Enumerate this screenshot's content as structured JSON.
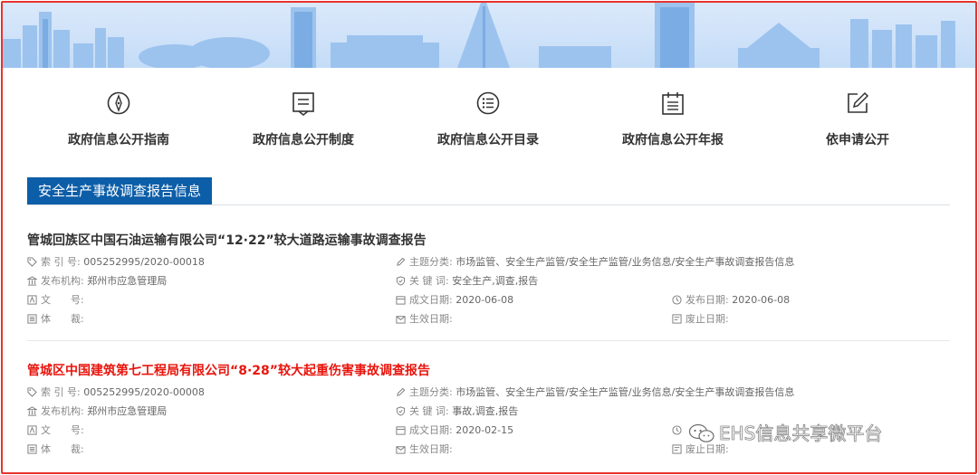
{
  "nav": [
    {
      "label": "政府信息公开指南",
      "icon": "compass-icon"
    },
    {
      "label": "政府信息公开制度",
      "icon": "document-icon"
    },
    {
      "label": "政府信息公开目录",
      "icon": "list-icon"
    },
    {
      "label": "政府信息公开年报",
      "icon": "calendar-icon"
    },
    {
      "label": "依申请公开",
      "icon": "edit-icon"
    }
  ],
  "section": {
    "title": "安全生产事故调查报告信息"
  },
  "articles": [
    {
      "title": "管城回族区中国石油运输有限公司“12·22”较大道路运输事故调查报告",
      "index_label": "索 引 号:",
      "index_value": "005252995/2020-00018",
      "category_label": "主题分类:",
      "category_value": "市场监管、安全生产监管/安全生产监管/业务信息/安全生产事故调查报告信息",
      "publisher_label": "发布机构:",
      "publisher_value": "郑州市应急管理局",
      "keywords_label": "关 键 词:",
      "keywords_value": "安全生产,调查,报告",
      "docnum_label": "文　　号:",
      "docnum_value": "",
      "created_label": "成文日期:",
      "created_value": "2020-06-08",
      "published_label": "发布日期:",
      "published_value": "2020-06-08",
      "genre_label": "体　　裁:",
      "genre_value": "",
      "effective_label": "生效日期:",
      "effective_value": "",
      "expiry_label": "废止日期:",
      "expiry_value": ""
    },
    {
      "title": "管城区中国建筑第七工程局有限公司“8·28”较大起重伤害事故调查报告",
      "index_label": "索 引 号:",
      "index_value": "005252995/2020-00008",
      "category_label": "主题分类:",
      "category_value": "市场监管、安全生产监管/安全生产监管/业务信息/安全生产事故调查报告信息",
      "publisher_label": "发布机构:",
      "publisher_value": "郑州市应急管理局",
      "keywords_label": "关 键 词:",
      "keywords_value": "事故,调查,报告",
      "docnum_label": "文　　号:",
      "docnum_value": "",
      "created_label": "成文日期:",
      "created_value": "2020-02-15",
      "published_label": "",
      "published_value": "",
      "genre_label": "体　　裁:",
      "genre_value": "",
      "effective_label": "生效日期:",
      "effective_value": "",
      "expiry_label": "废止日期:",
      "expiry_value": ""
    }
  ],
  "watermark": {
    "text": "EHS信息共享微平台"
  },
  "colors": {
    "frame": "#e8332e",
    "section_tab": "#0d5ea8",
    "title_highlight": "#e8150d"
  }
}
